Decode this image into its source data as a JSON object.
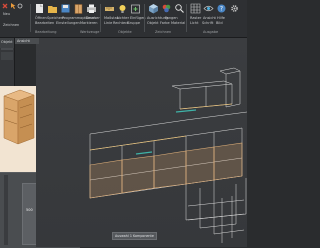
{
  "ribbon": {
    "row1": {
      "b0": "Neu",
      "b1": "Öffnen",
      "b2": "Speichern",
      "b3": "Speichern unter",
      "b4": "Programmoptionen",
      "b5": "Drucken",
      "b6": "Maßstab",
      "b7": "Lichter",
      "b8": "Einfügen",
      "b9": "Ausrichtung",
      "b10": "Fangen",
      "b11": "Raster",
      "b12": "Ansicht",
      "b13": "Hilfe"
    },
    "row2": {
      "b0": "Zeichnen",
      "b1": "Bearbeiten",
      "b2": "Einstellungen",
      "b3": "Markieren",
      "b4": "Linie",
      "b5": "Rechteck",
      "b6": "Gruppe",
      "b7": "Objekt",
      "b8": "Farbe",
      "b9": "Material",
      "b10": "Licht",
      "b11": "Schrift",
      "b12": "Bild"
    },
    "groups": {
      "g0": "Bearbeitung",
      "g1": "Werkzeuge",
      "g2": "Objekte",
      "g3": "Zeichnen",
      "g4": "Ausgabe"
    }
  },
  "left_panel": {
    "header_label": "Objekt",
    "dimension_label": "500"
  },
  "viewport": {
    "tab_label": "Ansicht",
    "status_label": "Auswahl 1 Komponente"
  },
  "colors": {
    "ribbon_bg": "#2e3033",
    "viewport_bg": "#3a3c3f",
    "cabinet_wood": "#d9a56a",
    "wireframe": "#dcdcdc",
    "accent_teal": "#3fb3a8",
    "preview_bg": "#f2e4d2"
  },
  "icons": [
    "red-cross-icon",
    "orange-cursor-icon",
    "rotate-icon",
    "new-file-icon",
    "folder-icon",
    "save-icon",
    "cabinet-icon",
    "light-icon",
    "ruler-icon",
    "print-icon",
    "search-icon",
    "help-icon"
  ]
}
